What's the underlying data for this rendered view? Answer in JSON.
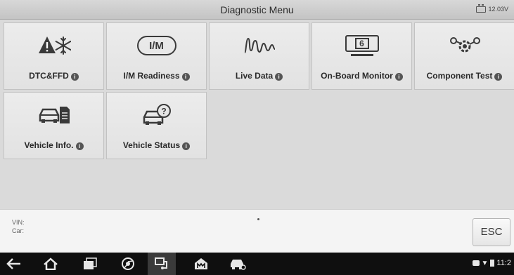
{
  "header": {
    "title": "Diagnostic Menu",
    "battery_voltage": "12.03V"
  },
  "tiles": [
    {
      "label": "DTC&FFD",
      "icon": "dtc-warning-snowflake-icon"
    },
    {
      "label": "I/M Readiness",
      "icon": "im-readiness-icon"
    },
    {
      "label": "Live Data",
      "icon": "live-data-waveform-icon"
    },
    {
      "label": "On-Board Monitor",
      "icon": "onboard-monitor-icon"
    },
    {
      "label": "Component Test",
      "icon": "component-test-icon"
    },
    {
      "label": "Vehicle Info.",
      "icon": "vehicle-info-icon"
    },
    {
      "label": "Vehicle Status",
      "icon": "vehicle-status-icon"
    }
  ],
  "info_symbol": "i",
  "monitor_number": "6",
  "im_text": "I/M",
  "vehicle_status_symbol": "?",
  "footer": {
    "vin_label": "VIN:",
    "car_label": "Car:",
    "esc_label": "ESC"
  },
  "navigation": {
    "buttons": [
      "back-icon",
      "home-icon",
      "recent-apps-icon",
      "chrome-icon",
      "vci-connection-icon",
      "maxisys-home-icon",
      "vehicle-icon"
    ],
    "clock": "11:2"
  },
  "colors": {
    "workspace_bg": "#dadada",
    "tile_bg": "#e6e6e6",
    "nav_bg": "#0f0f0f"
  }
}
